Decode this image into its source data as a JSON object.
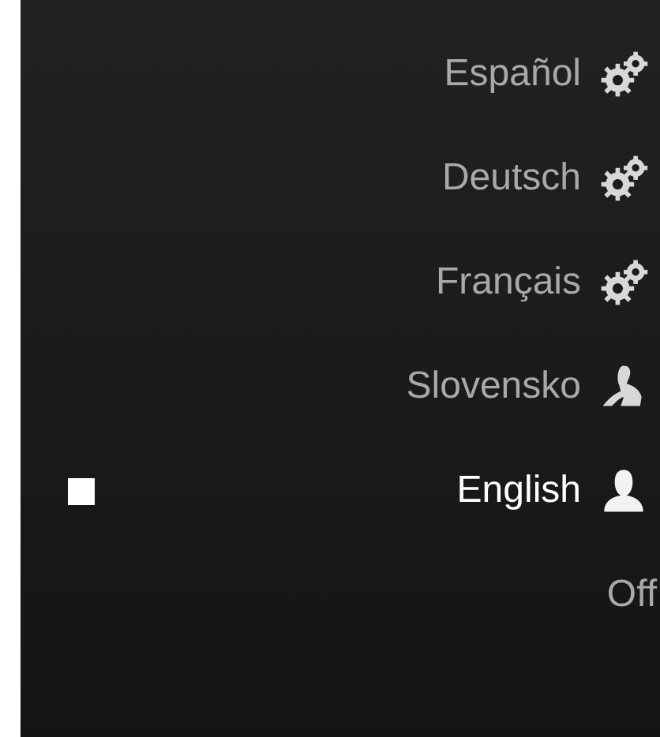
{
  "languages": [
    {
      "label": "Español",
      "kind": "gears",
      "selected": false
    },
    {
      "label": "Deutsch",
      "kind": "gears",
      "selected": false
    },
    {
      "label": "Français",
      "kind": "gears",
      "selected": false
    },
    {
      "label": "Slovensko",
      "kind": "voice",
      "selected": false
    },
    {
      "label": "English",
      "kind": "person",
      "selected": true
    },
    {
      "label": "Off",
      "kind": "none",
      "selected": false
    }
  ]
}
